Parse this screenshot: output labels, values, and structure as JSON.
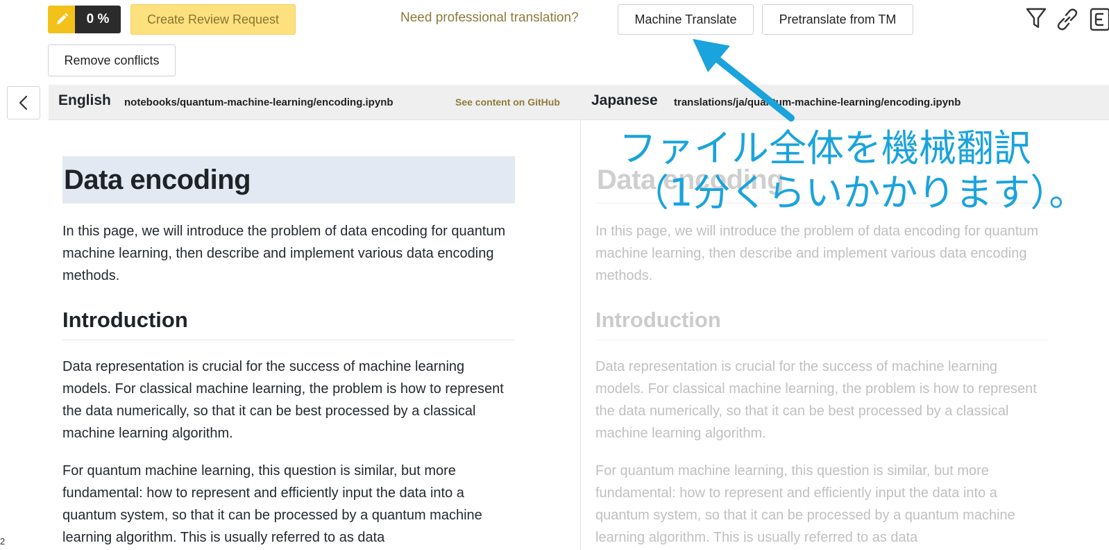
{
  "toolbar": {
    "progress": "0 %",
    "review_label": "Create Review Request",
    "need_translation": "Need professional translation?",
    "machine_translate": "Machine Translate",
    "pretranslate": "Pretranslate from TM",
    "remove_conflicts": "Remove conflicts",
    "icons": [
      "pencil-icon",
      "filter-icon",
      "link-icon",
      "document-icon"
    ]
  },
  "file_bar": {
    "source_lang": "English",
    "source_path": "notebooks/quantum-machine-learning/encoding.ipynb",
    "github_link": "See content on GitHub",
    "target_lang": "Japanese",
    "target_path": "translations/ja/quantum-machine-learning/encoding.ipynb"
  },
  "source": {
    "title": "Data encoding",
    "intro": "In this page, we will introduce the problem of data encoding for quantum machine learning, then describe and implement various data encoding methods.",
    "h2": "Introduction",
    "p2": "Data representation is crucial for the success of machine learning models. For classical machine learning, the problem is how to represent the data numerically, so that it can be best processed by a classical machine learning algorithm.",
    "p3": "For quantum machine learning, this question is similar, but more fundamental: how to represent and efficiently input the data into a quantum system, so that it can be processed by a quantum machine learning algorithm. This is usually referred to as data"
  },
  "target": {
    "title": "Data encoding",
    "intro": "In this page, we will introduce the problem of data encoding for quantum machine learning, then describe and implement various data encoding methods.",
    "h2": "Introduction",
    "p2": "Data representation is crucial for the success of machine learning models. For classical machine learning, the problem is how to represent the data numerically, so that it can be best processed by a classical machine learning algorithm.",
    "p3": "For quantum machine learning, this question is similar, but more fundamental: how to represent and efficiently input the data into a quantum system, so that it can be processed by a quantum machine learning algorithm. This is usually referred to as data"
  },
  "line_number": "2",
  "annotation": {
    "line1": "ファイル全体を機械翻訳",
    "line2": "（1分くらいかかります）。",
    "color": "#1aa3dd"
  },
  "colors": {
    "accent_yellow": "#f2c21b",
    "review_bg": "#fde17e",
    "gold_text": "#8f7a3b"
  }
}
